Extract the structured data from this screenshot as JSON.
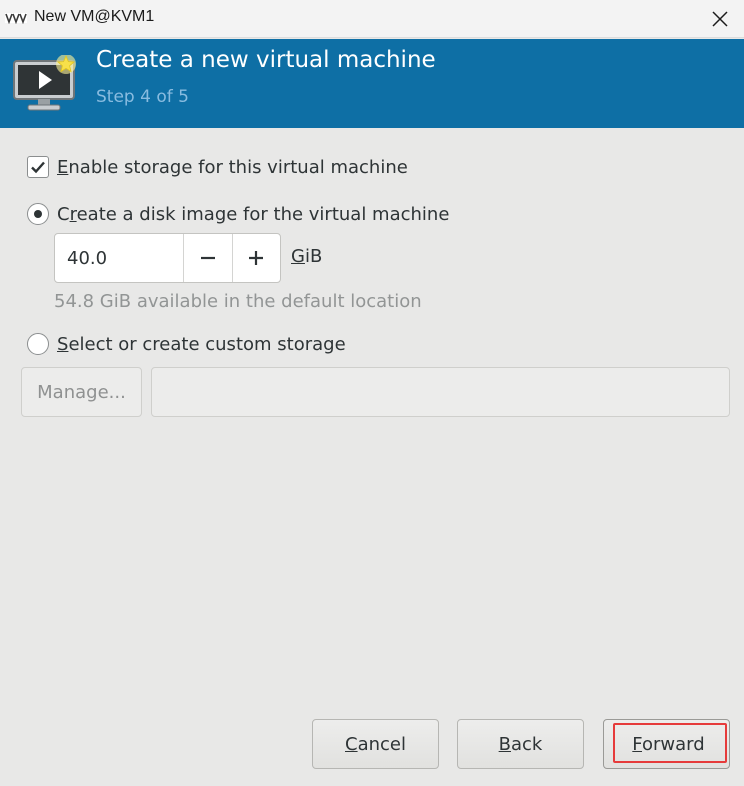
{
  "window": {
    "title": "New VM@KVM1",
    "close_icon": "close-icon"
  },
  "header": {
    "title": "Create a new virtual machine",
    "step": "Step 4 of 5",
    "background_color": "#0e6fa5"
  },
  "storage": {
    "enable_label_mnemonic": "E",
    "enable_label_rest": "nable storage for this virtual machine",
    "enable_checked": true,
    "create_disk_label_pre": "C",
    "create_disk_label_mnemonic": "r",
    "create_disk_label_rest": "eate a disk image for the virtual machine",
    "create_disk_selected": true,
    "disk_size_value": "40.0",
    "unit_mnemonic": "G",
    "unit_rest": "iB",
    "available_hint": "54.8 GiB available in the default location",
    "custom_label_mnemonic": "S",
    "custom_label_rest": "elect or create custom storage",
    "custom_selected": false,
    "manage_button_label": "Manage...",
    "custom_path_value": ""
  },
  "footer": {
    "cancel_mnemonic": "C",
    "cancel_rest": "ancel",
    "back_mnemonic": "B",
    "back_rest": "ack",
    "forward_mnemonic": "F",
    "forward_rest": "orward",
    "focus_color": "#e63b3b"
  }
}
